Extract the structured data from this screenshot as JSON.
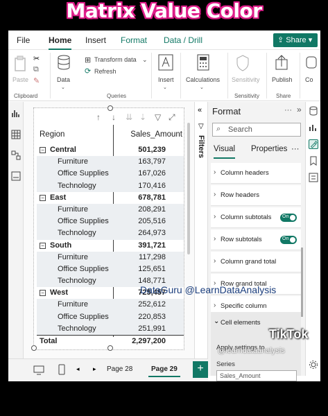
{
  "overlay": {
    "title": "Matrix Value Color"
  },
  "menu": {
    "items": [
      "File",
      "Home",
      "Insert",
      "Format",
      "Data / Drill"
    ],
    "active": "Home",
    "share_label": "Share"
  },
  "ribbon": {
    "paste": "Paste",
    "data": "Data",
    "transform": "Transform data",
    "refresh": "Refresh",
    "insert": "Insert",
    "calculations": "Calculations",
    "sensitivity": "Sensitivity",
    "publish": "Publish",
    "co": "Co",
    "groups": {
      "clipboard": "Clipboard",
      "queries": "Queries",
      "sensitivity": "Sensitivity",
      "share": "Share"
    }
  },
  "matrix": {
    "headers": [
      "Region",
      "Sales_Amount"
    ],
    "rows": [
      {
        "label": "Central",
        "value": "501,239",
        "kind": "parent"
      },
      {
        "label": "Furniture",
        "value": "163,797",
        "kind": "child"
      },
      {
        "label": "Office Supplies",
        "value": "167,026",
        "kind": "child"
      },
      {
        "label": "Technology",
        "value": "170,416",
        "kind": "child"
      },
      {
        "label": "East",
        "value": "678,781",
        "kind": "parent"
      },
      {
        "label": "Furniture",
        "value": "208,291",
        "kind": "child"
      },
      {
        "label": "Office Supplies",
        "value": "205,516",
        "kind": "child"
      },
      {
        "label": "Technology",
        "value": "264,973",
        "kind": "child"
      },
      {
        "label": "South",
        "value": "391,721",
        "kind": "parent"
      },
      {
        "label": "Furniture",
        "value": "117,298",
        "kind": "child"
      },
      {
        "label": "Office Supplies",
        "value": "125,651",
        "kind": "child"
      },
      {
        "label": "Technology",
        "value": "148,771",
        "kind": "child"
      },
      {
        "label": "West",
        "value": "725,457",
        "kind": "parent"
      },
      {
        "label": "Furniture",
        "value": "252,612",
        "kind": "child"
      },
      {
        "label": "Office Supplies",
        "value": "220,853",
        "kind": "child"
      },
      {
        "label": "Technology",
        "value": "251,991",
        "kind": "child"
      }
    ],
    "total_label": "Total",
    "total_value": "2,297,200"
  },
  "filters_label": "Filters",
  "format_pane": {
    "title": "Format",
    "search_placeholder": "Search",
    "tabs": [
      "Visual",
      "Properties"
    ],
    "sections": [
      {
        "label": "Column headers",
        "toggle": ""
      },
      {
        "label": "Row headers",
        "toggle": ""
      },
      {
        "label": "Column subtotals",
        "toggle": "On"
      },
      {
        "label": "Row subtotals",
        "toggle": "On"
      },
      {
        "label": "Column grand total",
        "toggle": ""
      },
      {
        "label": "Row grand total",
        "toggle": ""
      },
      {
        "label": "Specific column",
        "toggle": ""
      }
    ],
    "cell_elements": "Cell elements",
    "apply_settings": "Apply settings to",
    "series_label": "Series",
    "series_value": "Sales_Amount"
  },
  "pages": {
    "tabs": [
      "Page 28",
      "Page 29"
    ],
    "active": "Page 29",
    "add": "+"
  },
  "watermarks": {
    "credit": "DataGuru @LearnDataAnalysis",
    "tiktok": "TikTok",
    "handle": "@learndataanalysis"
  },
  "colors": {
    "accent": "#117865",
    "band": "#eceff2",
    "title_glow": "#e0208c"
  }
}
